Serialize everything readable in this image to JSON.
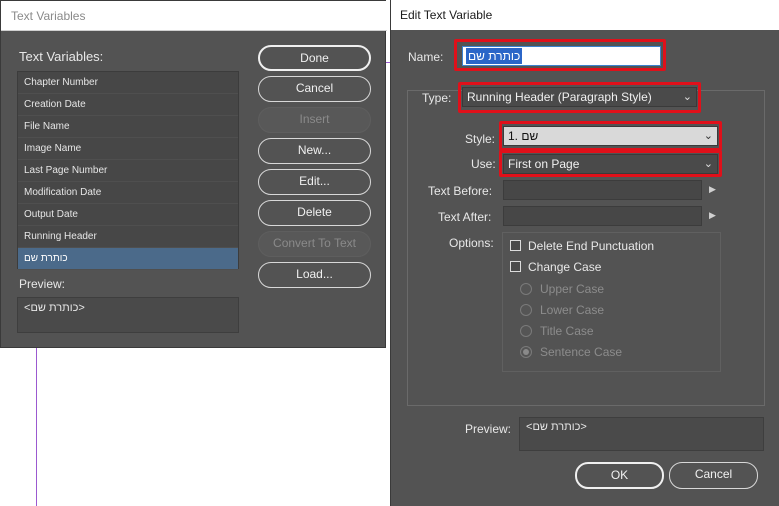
{
  "text_variables_dialog": {
    "title": "Text Variables",
    "list_label": "Text Variables:",
    "items": [
      {
        "label": "Chapter Number"
      },
      {
        "label": "Creation Date"
      },
      {
        "label": "File Name"
      },
      {
        "label": "Image Name"
      },
      {
        "label": "Last Page Number"
      },
      {
        "label": "Modification Date"
      },
      {
        "label": "Output Date"
      },
      {
        "label": "Running Header"
      },
      {
        "label": "כותרת שם",
        "selected": true
      }
    ],
    "preview_label": "Preview:",
    "preview_value": "<כותרת שם>",
    "buttons": {
      "done": "Done",
      "cancel": "Cancel",
      "insert": "Insert",
      "new": "New...",
      "edit": "Edit...",
      "delete": "Delete",
      "convert": "Convert To Text",
      "load": "Load..."
    }
  },
  "edit_dialog": {
    "title": "Edit Text Variable",
    "name_label": "Name:",
    "name_value": "כותרת שם",
    "type_label": "Type:",
    "type_value": "Running Header (Paragraph Style)",
    "style_label": "Style:",
    "style_value": "1. שם",
    "use_label": "Use:",
    "use_value": "First on Page",
    "text_before_label": "Text Before:",
    "text_after_label": "Text After:",
    "options_label": "Options:",
    "checkboxes": [
      {
        "label": "Delete End Punctuation",
        "checked": false
      },
      {
        "label": "Change Case",
        "checked": false
      }
    ],
    "radios": [
      {
        "label": "Upper Case",
        "selected": false
      },
      {
        "label": "Lower Case",
        "selected": false
      },
      {
        "label": "Title Case",
        "selected": false
      },
      {
        "label": "Sentence Case",
        "selected": true
      }
    ],
    "preview_label": "Preview:",
    "preview_value": "<כותרת שם>",
    "ok_label": "OK",
    "cancel_label": "Cancel"
  },
  "colors": {
    "dialog_bg": "#535353",
    "highlight_red": "#e0101a",
    "selection_blue": "#2b66c8",
    "list_selected": "#4b6a8a"
  },
  "icons": [
    "chevron-down-icon",
    "arrow-right-icon"
  ]
}
